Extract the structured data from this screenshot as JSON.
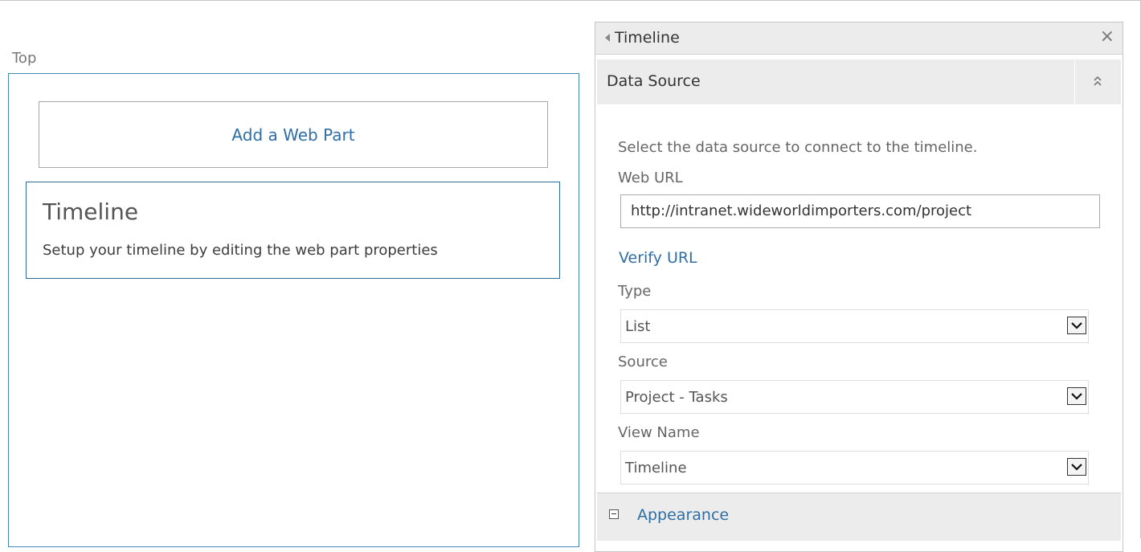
{
  "zone": {
    "label": "Top",
    "add_webpart_label": "Add a Web Part",
    "webpart": {
      "title": "Timeline",
      "description": "Setup your timeline by editing the web part properties"
    }
  },
  "toolpane": {
    "title": "Timeline",
    "close_symbol": "×",
    "section": {
      "title": "Data Source",
      "instruction": "Select the data source to connect to the timeline.",
      "web_url_label": "Web URL",
      "web_url_value": "http://intranet.wideworldimporters.com/project",
      "verify_link": "Verify URL",
      "type_label": "Type",
      "type_value": "List",
      "source_label": "Source",
      "source_value": "Project - Tasks",
      "view_label": "View Name",
      "view_value": "Timeline"
    },
    "appearance_title": "Appearance"
  },
  "icons": {
    "collapse": "left-triangle",
    "close": "x",
    "section_toggle": "double-chevron-up",
    "dropdown": "chevron-down",
    "appearance_toggle": "minus-box"
  },
  "colors": {
    "link": "#2f6ea4",
    "zone_border": "#3f8ab7",
    "header_bg": "#ececec"
  }
}
